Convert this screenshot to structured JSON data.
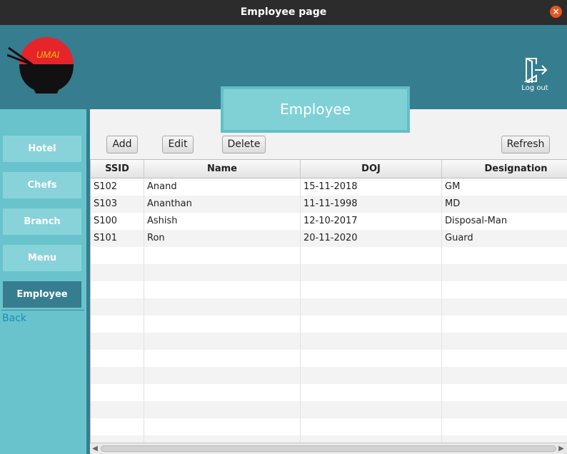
{
  "window": {
    "title": "Employee page"
  },
  "header": {
    "logo_text": "UMAI",
    "logout_label": "Log out",
    "page_title": "Employee"
  },
  "sidebar": {
    "items": [
      {
        "label": "Hotel",
        "active": false
      },
      {
        "label": "Chefs",
        "active": false
      },
      {
        "label": "Branch",
        "active": false
      },
      {
        "label": "Menu",
        "active": false
      },
      {
        "label": "Employee",
        "active": true
      }
    ],
    "back_label": "Back"
  },
  "toolbar": {
    "add_label": "Add",
    "edit_label": "Edit",
    "delete_label": "Delete",
    "refresh_label": "Refresh"
  },
  "table": {
    "columns": [
      "SSID",
      "Name",
      "DOJ",
      "Designation"
    ],
    "rows": [
      [
        "S102",
        "Anand",
        "15-11-2018",
        "GM"
      ],
      [
        "S103",
        "Ananthan",
        "11-11-1998",
        "MD"
      ],
      [
        "S100",
        "Ashish",
        "12-10-2017",
        "Disposal-Man"
      ],
      [
        "S101",
        "Ron",
        "20-11-2020",
        "Guard"
      ]
    ]
  },
  "colors": {
    "header": "#357d8f",
    "sidebar": "#69c3cc",
    "nav_button": "#88d3d9",
    "banner": "#7fd1d6",
    "close": "#e95420"
  }
}
